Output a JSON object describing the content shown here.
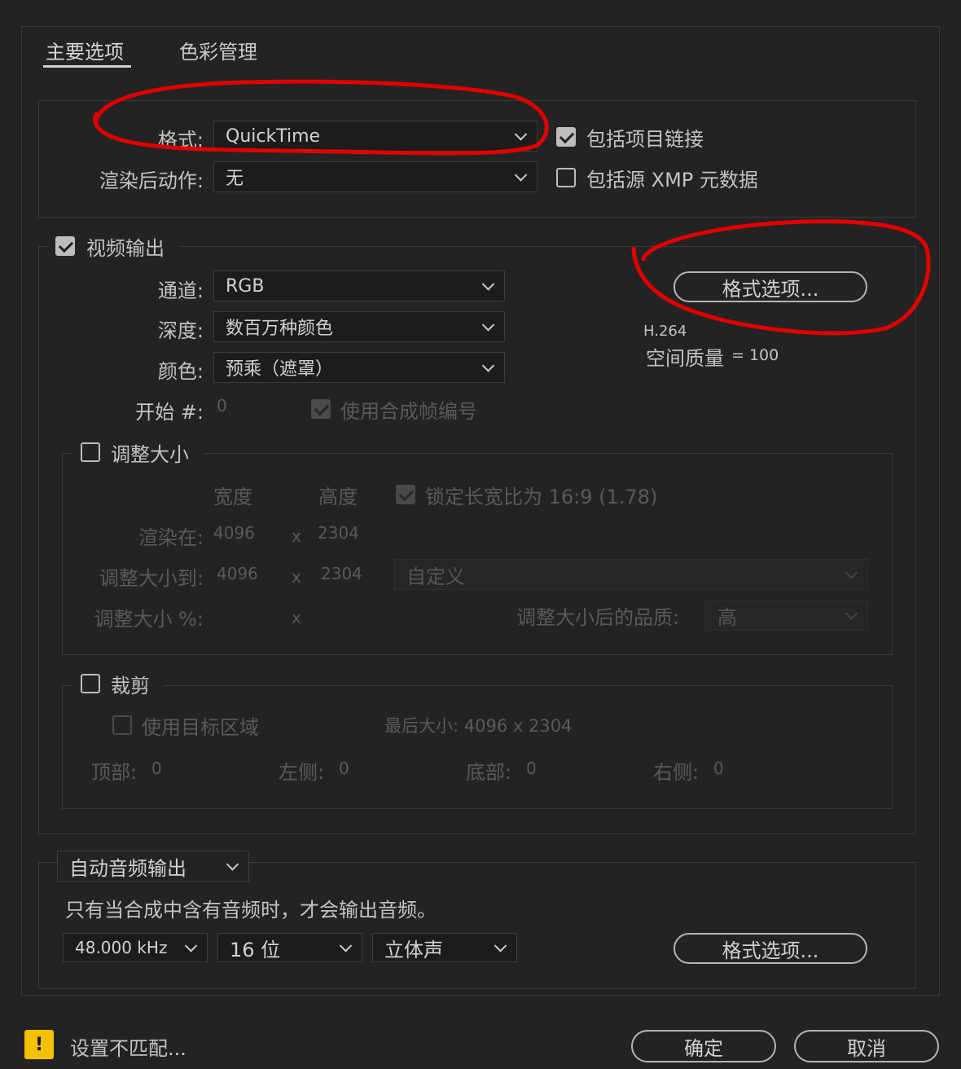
{
  "tabs": [
    {
      "label": "主要选项",
      "active": true
    },
    {
      "label": "色彩管理",
      "active": false
    }
  ],
  "format": {
    "format_label": "格式:",
    "format_value": "QuickTime",
    "post_render_label": "渲染后动作:",
    "post_render_value": "无",
    "include_project_link": {
      "label": "包括项目链接",
      "checked": true
    },
    "include_xmp": {
      "label": "包括源 XMP 元数据",
      "checked": false
    }
  },
  "video_output": {
    "label": "视频输出",
    "checked": true,
    "channels_label": "通道:",
    "channels_value": "RGB",
    "depth_label": "深度:",
    "depth_value": "数百万种颜色",
    "color_label": "颜色:",
    "color_value": "预乘（遮罩）",
    "start_label": "开始 #:",
    "start_value": "0",
    "use_comp_frame": {
      "label": "使用合成帧编号",
      "checked": true
    },
    "format_options_button": "格式选项...",
    "codec": "H.264",
    "quality_label": "空间质量",
    "quality_value": "= 100"
  },
  "resize": {
    "label": "调整大小",
    "checked": false,
    "width_header": "宽度",
    "height_header": "高度",
    "lock_aspect": {
      "label": "锁定长宽比为 16:9 (1.78)",
      "checked": true
    },
    "render_at_label": "渲染在:",
    "render_at_w": "4096",
    "render_at_h": "2304",
    "resize_to_label": "调整大小到:",
    "resize_to_w": "4096",
    "resize_to_h": "2304",
    "x": "x",
    "preset_value": "自定义",
    "percent_label": "调整大小 %:",
    "quality_label": "调整大小后的品质:",
    "quality_value": "高"
  },
  "crop": {
    "label": "裁剪",
    "checked": false,
    "use_roi": {
      "label": "使用目标区域",
      "checked": false
    },
    "final_size": "最后大小: 4096 x 2304",
    "top_label": "顶部:",
    "top_value": "0",
    "left_label": "左侧:",
    "left_value": "0",
    "bottom_label": "底部:",
    "bottom_value": "0",
    "right_label": "右侧:",
    "right_value": "0"
  },
  "audio": {
    "mode_value": "自动音频输出",
    "note": "只有当合成中含有音频时，才会输出音频。",
    "sample_rate": "48.000 kHz",
    "bit_depth": "16 位",
    "channels": "立体声",
    "format_options_button": "格式选项..."
  },
  "footer": {
    "warning_text": "设置不匹配...",
    "ok_button": "确定",
    "cancel_button": "取消"
  },
  "colors": {
    "background": "#232323",
    "annotation_red": "#e00000",
    "warning_yellow": "#f2c200"
  }
}
